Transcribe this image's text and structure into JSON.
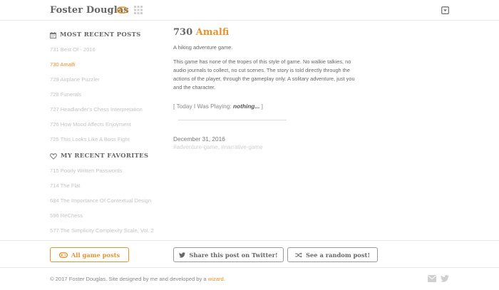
{
  "header": {
    "site_title": "Foster Douglas",
    "icons": [
      "gamepad-icon",
      "grid-icon",
      "menu-dropdown-icon"
    ],
    "accent_color": "#e6932a"
  },
  "sidebar": {
    "recent_heading": "MOST RECENT POSTS",
    "recent_posts": [
      "731 Best Of - 2016",
      "730 Amalfi",
      "729 Airplane Puzzler",
      "728 Funerals",
      "727 Headlander's Chess Interpretation",
      "726 How Mood Affects Enjoyment",
      "725 This Looks Like A Boss Fight"
    ],
    "active_index": 1,
    "favorites_heading": "MY RECENT FAVORITES",
    "favorites": [
      "715 Poorly Written Passwords",
      "714 The Flat",
      "684 The Importance Of Contextual Design",
      "596 ReChess",
      "577 The Simplicity Complexity Scale, Vol. 2"
    ]
  },
  "post": {
    "number": "730",
    "title": "Amalfi",
    "subtitle": "A hiking adventure game.",
    "body": "This game has none of the tropes of this style of game. No walkie talkies, no audio journals to collect, no cut scenes. The story is told directly through the actions of the player, through the gameplay only. A solitary adventure, just you and the character.",
    "playing_prefix": "[ Today I Was Playing: ",
    "playing_game": "nothing...",
    "playing_suffix": " ]",
    "date": "December 31, 2016",
    "tags": "#adventure-game, #narrative-game"
  },
  "actions": {
    "all_games": "All game posts",
    "share_twitter": "Share this post on Twitter!",
    "random_post": "See a random post!"
  },
  "footer": {
    "text": "© 2017 Foster Douglas. Site designed by me and developed by a ",
    "link_text": "wizard",
    "end": ".",
    "icons": [
      "mail-icon",
      "twitter-icon"
    ]
  }
}
